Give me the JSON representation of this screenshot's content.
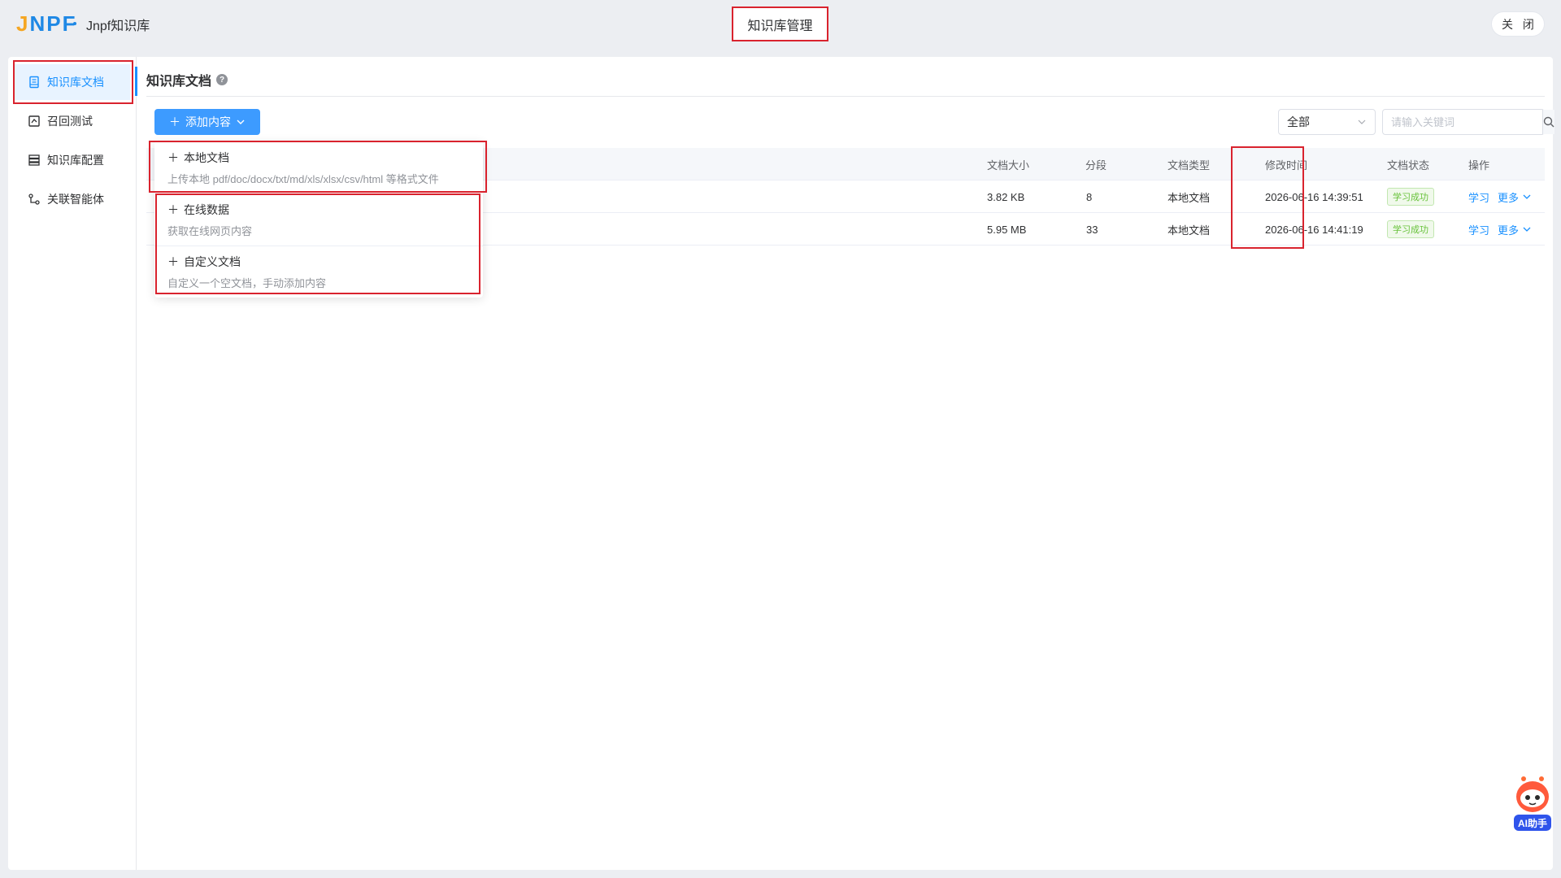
{
  "header": {
    "logo_j": "J",
    "logo_npf": "NPF",
    "app_name": "Jnpf知识库",
    "center_title": "知识库管理",
    "close_label": "关 闭"
  },
  "sidebar": {
    "items": [
      {
        "label": "知识库文档",
        "icon": "document-icon",
        "active": true
      },
      {
        "label": "召回测试",
        "icon": "recall-test-icon",
        "active": false
      },
      {
        "label": "知识库配置",
        "icon": "config-icon",
        "active": false
      },
      {
        "label": "关联智能体",
        "icon": "agent-link-icon",
        "active": false
      }
    ]
  },
  "main": {
    "title": "知识库文档",
    "add_button_label": "添加内容",
    "filter_value": "全部",
    "search_placeholder": "请输入关键词"
  },
  "table": {
    "columns": [
      "文档大小",
      "分段",
      "文档类型",
      "修改时间",
      "文档状态",
      "操作"
    ],
    "rows": [
      {
        "size": "3.82 KB",
        "segments": "8",
        "type": "本地文档",
        "modified": "2026-06-16 14:39:51",
        "status": "学习成功",
        "action_learn": "学习",
        "action_more": "更多"
      },
      {
        "size": "5.95 MB",
        "segments": "33",
        "type": "本地文档",
        "modified": "2026-06-16 14:41:19",
        "status": "学习成功",
        "action_learn": "学习",
        "action_more": "更多"
      }
    ]
  },
  "dropdown": {
    "items": [
      {
        "title": "本地文档",
        "desc": "上传本地 pdf/doc/docx/txt/md/xls/xlsx/csv/html 等格式文件"
      },
      {
        "title": "在线数据",
        "desc": "获取在线网页内容"
      },
      {
        "title": "自定义文档",
        "desc": "自定义一个空文档，手动添加内容"
      }
    ]
  },
  "ai_helper": {
    "label": "AI助手"
  },
  "colors": {
    "primary": "#1890ff",
    "button": "#3d9bff",
    "highlight": "#d9232e",
    "success": "#67c23a"
  }
}
